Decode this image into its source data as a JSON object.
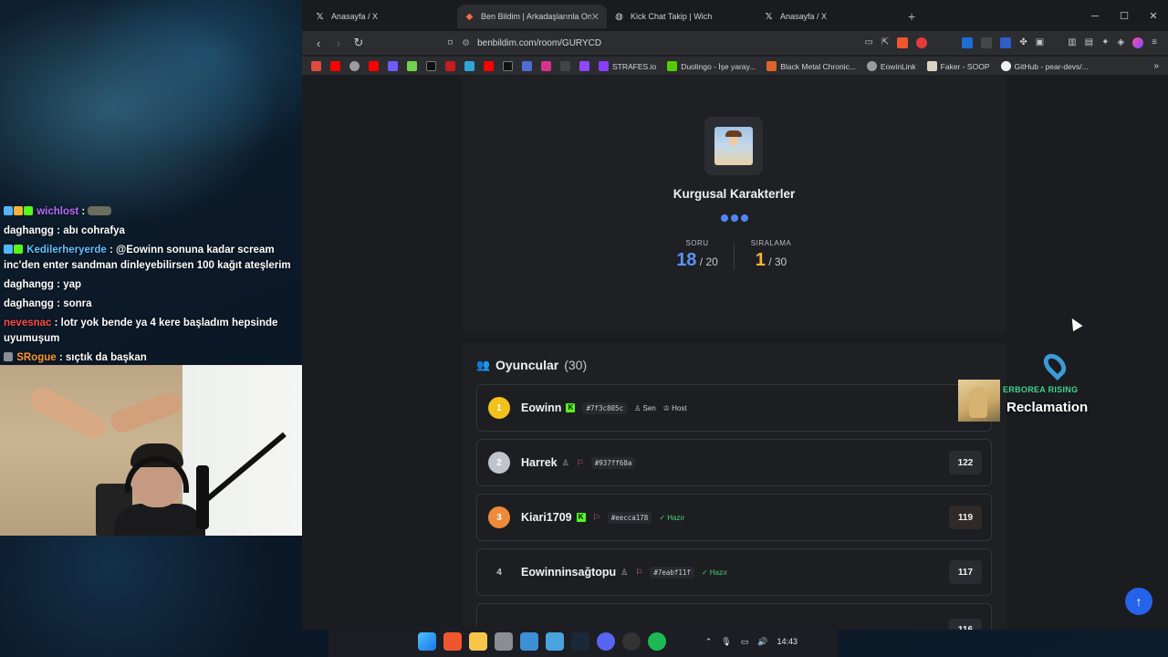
{
  "chat": {
    "messages": [
      {
        "user": "wichlost",
        "text": "",
        "color": "#b96bff"
      },
      {
        "user": "daghangg",
        "text": "abı cohrafya",
        "color": "#ffffff"
      },
      {
        "user": "Kedilerheryerde",
        "text": "@Eowinn sonuna kadar scream inc'den enter sandman dinleyebilirsen 100 kağıt ateşlerim",
        "color": "#5fc0ff"
      },
      {
        "user": "daghangg",
        "text": "yap",
        "color": "#ffffff"
      },
      {
        "user": "daghangg",
        "text": "sonra",
        "color": "#ffffff"
      },
      {
        "user": "nevesnac",
        "text": "lotr yok bende ya 4 kere başladım hepsinde uyumuşum",
        "color": "#ff4a4a"
      },
      {
        "user": "SRogue",
        "text": "sıçtık da başkan",
        "color": "#ff9a2e"
      }
    ]
  },
  "browser": {
    "tabs": [
      {
        "label": "Anasayfa / X",
        "icon": "x-logo-icon",
        "active": false
      },
      {
        "label": "Ben Bildim | Arkadaşlarınla Onlin",
        "icon": "benbildim-icon",
        "active": true
      },
      {
        "label": "Kick Chat Takip | Wich",
        "icon": "globe-icon",
        "active": false
      },
      {
        "label": "Anasayfa / X",
        "icon": "x-logo-icon",
        "active": false
      }
    ],
    "url": "benbildim.com/room/GURYCD",
    "bookmarks": [
      {
        "label": "STRAFES.io"
      },
      {
        "label": "Duolingo - İşe yaray..."
      },
      {
        "label": "Black Metal Chronic..."
      },
      {
        "label": "EowinLink"
      },
      {
        "label": "Faker - SOOP"
      },
      {
        "label": "GitHub - pear-devs/..."
      }
    ],
    "shield_count": "3"
  },
  "quiz": {
    "category": "Kurgusal Karakterler",
    "question_label": "SORU",
    "question_current": "18",
    "question_total": "/ 20",
    "rank_label": "SIRALAMA",
    "rank_current": "1",
    "rank_total": "/ 30"
  },
  "players": {
    "title": "Oyuncular",
    "count": "(30)",
    "list": [
      {
        "rank": "1",
        "name": "Eowinn",
        "kick": true,
        "hash": "#7f3c805c",
        "you": "Sen",
        "host": "Host",
        "ready": "",
        "score": "",
        "rank_color": "#f2c21a"
      },
      {
        "rank": "2",
        "name": "Harrek",
        "kick": false,
        "hash": "#937ff68a",
        "you": "",
        "host": "",
        "ready": "",
        "score": "122",
        "rank_color": "#bfc3cb"
      },
      {
        "rank": "3",
        "name": "Kiari1709",
        "kick": true,
        "hash": "#eecca178",
        "you": "",
        "host": "",
        "ready": "Hazır",
        "score": "119",
        "rank_color": "#ef8a3a"
      },
      {
        "rank": "4",
        "name": "Eowinninsağtopu",
        "kick": false,
        "hash": "#7eabf11f",
        "you": "",
        "host": "",
        "ready": "Hazır",
        "score": "117",
        "rank_color": "transparent"
      }
    ],
    "partial_score": "116"
  },
  "overlay": {
    "music_sub": "ERBOREA RISING",
    "music_title": "Reclamation"
  },
  "taskbar": {
    "time": "14:43"
  }
}
